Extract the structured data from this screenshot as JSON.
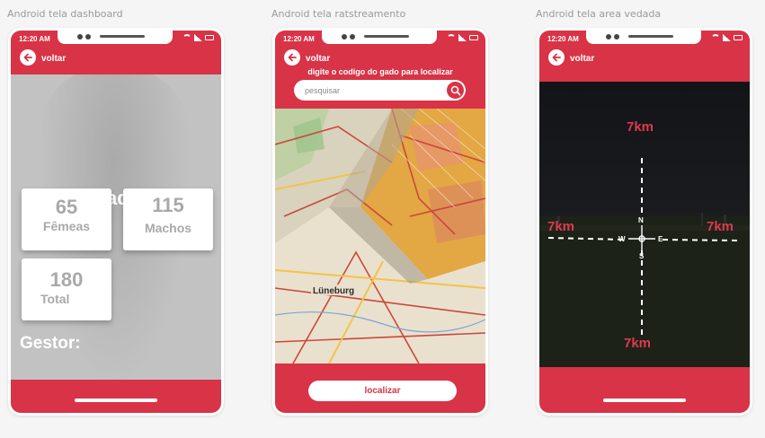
{
  "frames": [
    {
      "label": "Android tela dashboard",
      "status_time": "12:20 AM",
      "back_label": "voltar",
      "title": "Gado",
      "stats": [
        {
          "value": "65",
          "label": "Fêmeas"
        },
        {
          "value": "115",
          "label": "Machos"
        },
        {
          "value": "180",
          "label": "Total"
        }
      ],
      "gestor_label": "Gestor:"
    },
    {
      "label": "Android tela ratstreamento",
      "status_time": "12:20 AM",
      "back_label": "voltar",
      "prompt": "digite o codigo do gado para localizar",
      "search_placeholder": "pesquisar",
      "locate_button": "localizar"
    },
    {
      "label": "Android tela area vedada",
      "status_time": "12:20 AM",
      "back_label": "voltar",
      "distances": {
        "north": "7km",
        "west": "7km",
        "east": "7km",
        "south": "7km"
      },
      "compass": {
        "n": "N",
        "s": "S",
        "w": "W",
        "e": "E"
      }
    }
  ],
  "colors": {
    "brand": "#d83346",
    "background": "#f5f5f5",
    "stat_text": "#a9a9a9"
  },
  "icons": [
    "back-arrow-icon",
    "search-icon",
    "wifi-icon",
    "signal-icon",
    "battery-icon",
    "compass-icon"
  ]
}
